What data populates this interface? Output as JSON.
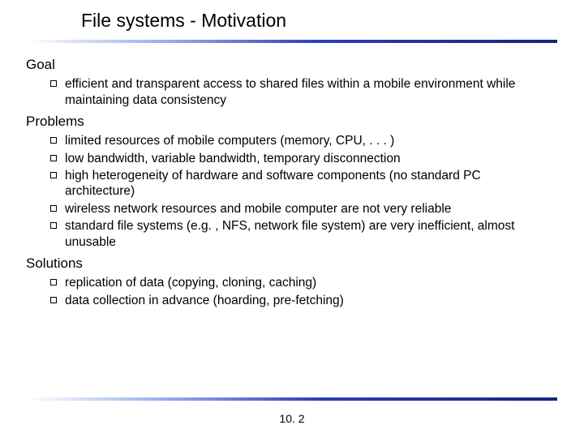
{
  "title": "File systems - Motivation",
  "sections": [
    {
      "heading": "Goal",
      "items": [
        "efficient and transparent access to shared files within a mobile environment while maintaining data consistency"
      ]
    },
    {
      "heading": "Problems",
      "items": [
        "limited resources of mobile computers (memory, CPU, . . . )",
        "low bandwidth, variable bandwidth, temporary disconnection",
        "high heterogeneity of hardware and software components (no standard PC architecture)",
        "wireless network resources and mobile computer are not very reliable",
        "standard file systems (e.g. , NFS, network file system) are very inefficient, almost unusable"
      ]
    },
    {
      "heading": "Solutions",
      "items": [
        "replication of data (copying, cloning, caching)",
        "data collection in advance (hoarding, pre-fetching)"
      ]
    }
  ],
  "page_number": "10. 2"
}
